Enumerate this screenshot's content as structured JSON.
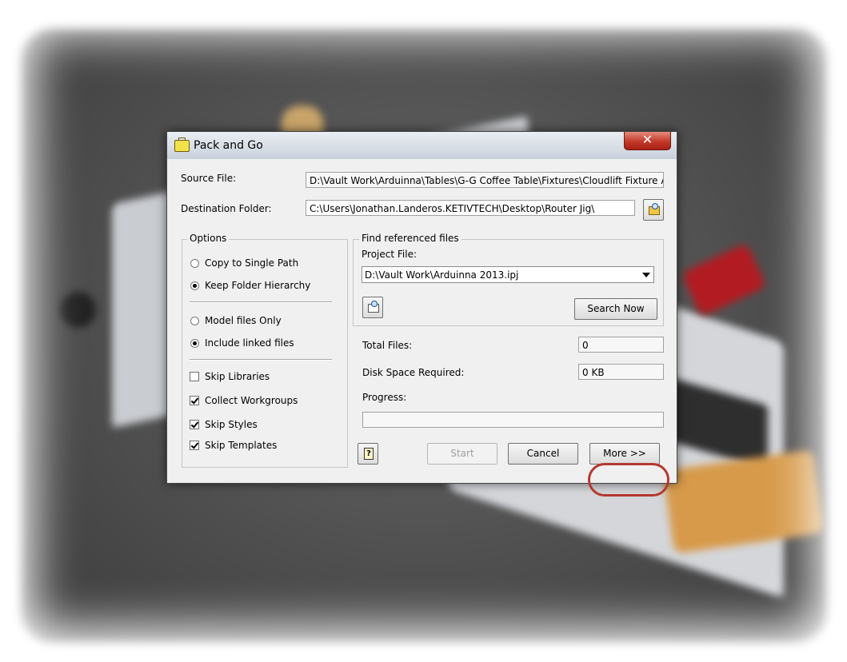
{
  "window": {
    "title": "Pack and Go",
    "close_label": "✕"
  },
  "source": {
    "label": "Source File:",
    "value": "D:\\Vault Work\\Arduinna\\Tables\\G-G Coffee Table\\Fixtures\\Cloudlift Fixture Ap"
  },
  "destination": {
    "label": "Destination Folder:",
    "value": "C:\\Users\\Jonathan.Landeros.KETIVTECH\\Desktop\\Router Jig\\"
  },
  "options": {
    "legend": "Options",
    "copy_single_path": "Copy to Single Path",
    "keep_folder_hierarchy": "Keep Folder Hierarchy",
    "model_files_only": "Model files Only",
    "include_linked_files": "Include linked files",
    "skip_libraries": "Skip Libraries",
    "collect_workgroups": "Collect Workgroups",
    "skip_styles": "Skip Styles",
    "skip_templates": "Skip Templates"
  },
  "find": {
    "legend": "Find referenced files",
    "project_label": "Project File:",
    "project_value": "D:\\Vault Work\\Arduinna 2013.ipj",
    "search_now": "Search Now"
  },
  "stats": {
    "total_files_label": "Total Files:",
    "total_files_value": "0",
    "disk_space_label": "Disk Space Required:",
    "disk_space_value": "0 KB",
    "progress_label": "Progress:",
    "progress": 0
  },
  "buttons": {
    "start": "Start",
    "cancel": "Cancel",
    "more": "More >>"
  },
  "colors": {
    "highlight": "#b5392e",
    "close": "#c2392a"
  }
}
